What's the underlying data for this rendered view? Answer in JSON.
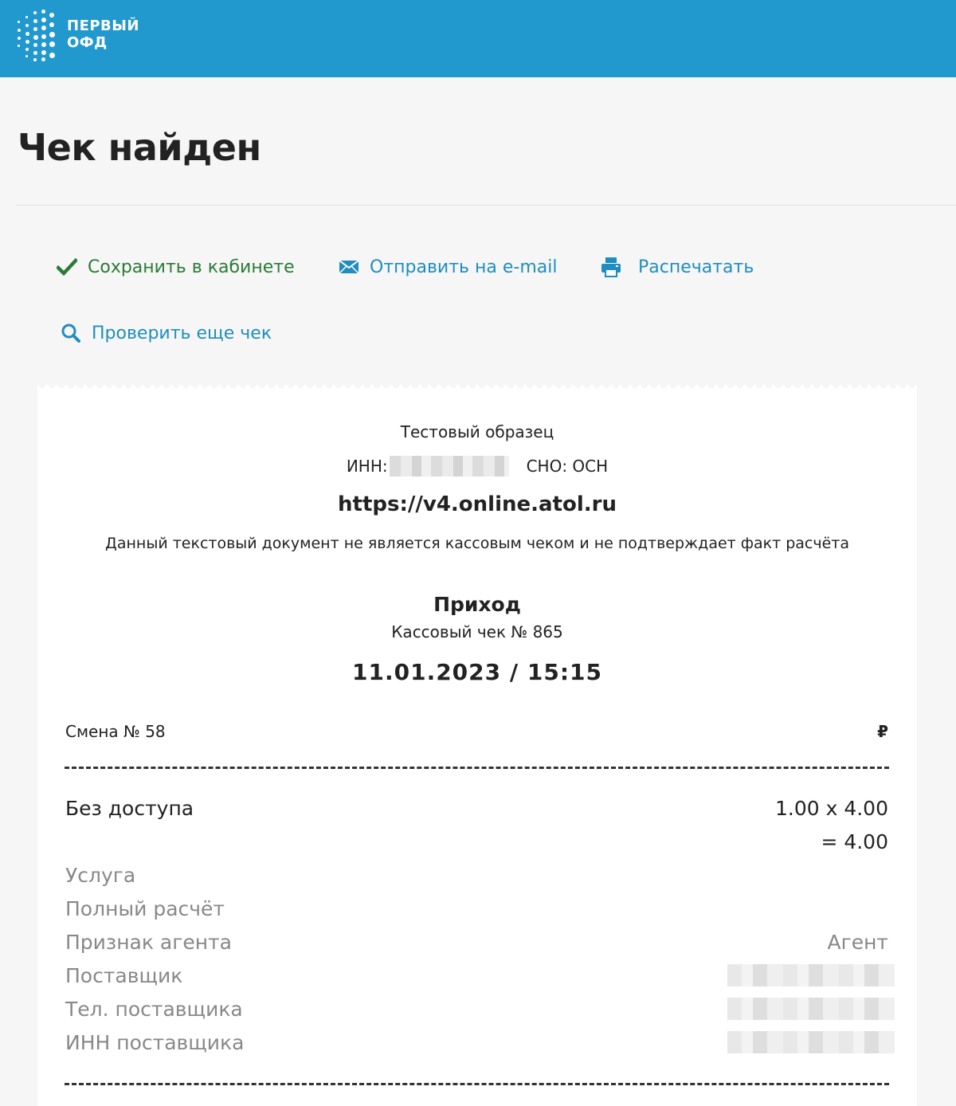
{
  "header": {
    "logo_line1": "ПЕРВЫЙ",
    "logo_line2": "ОФД",
    "brand_color": "#2199cf"
  },
  "page": {
    "title": "Чек найден"
  },
  "actions": {
    "save_label": "Сохранить в кабинете",
    "save_icon": "checkmark-icon",
    "email_label": "Отправить на e-mail",
    "email_icon": "envelope-icon",
    "print_label": "Распечатать",
    "print_icon": "printer-icon",
    "check_label": "Проверить еще чек",
    "check_icon": "search-icon"
  },
  "receipt": {
    "org_name": "Тестовый образец",
    "inn_label": "ИНН:",
    "tax_system": "СНО: ОСН",
    "site_url": "https://v4.online.atol.ru",
    "disclaimer": "Данный текстовый документ не является кассовым чеком и не подтверждает факт расчёта",
    "doc_type": "Приход",
    "receipt_number": "Кассовый чек  № 865",
    "datetime": "11.01.2023 / 15:15",
    "shift": "Смена № 58",
    "currency": "₽",
    "item": {
      "name": "Без доступа",
      "calc": "1.00 x 4.00",
      "total": "= 4.00"
    },
    "properties": {
      "subject": "Услуга",
      "payment_method": "Полный расчёт",
      "agent_sign_label": "Признак агента",
      "agent_sign_value": "Агент",
      "supplier_label": "Поставщик",
      "supplier_phone_label": "Тел. поставщика",
      "supplier_inn_label": "ИНН поставщика"
    }
  }
}
